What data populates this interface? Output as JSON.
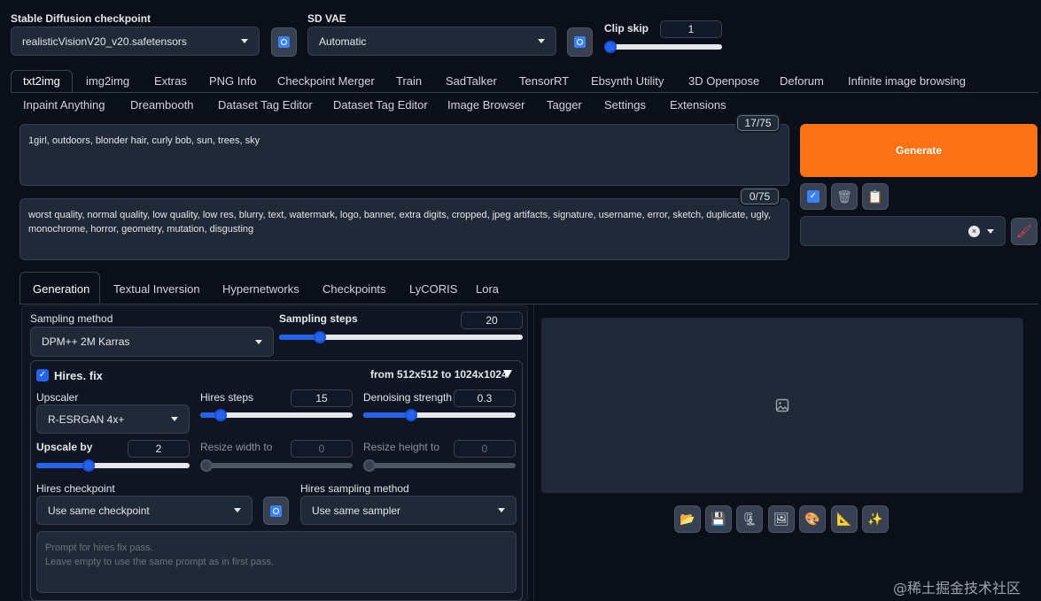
{
  "top": {
    "checkpoint_label": "Stable Diffusion checkpoint",
    "checkpoint_value": "realisticVisionV20_v20.safetensors",
    "vae_label": "SD VAE",
    "vae_value": "Automatic",
    "clip_label": "Clip skip",
    "clip_value": "1",
    "clip_level": 0.0
  },
  "tabs_row1": [
    "txt2img",
    "img2img",
    "Extras",
    "PNG Info",
    "Checkpoint Merger",
    "Train",
    "SadTalker",
    "TensorRT",
    "Ebsynth Utility",
    "3D Openpose",
    "Deforum",
    "Infinite image browsing"
  ],
  "tabs_row2": [
    "Inpaint Anything",
    "Dreambooth",
    "Dataset Tag Editor",
    "Dataset Tag Editor",
    "Image Browser",
    "Tagger",
    "Settings",
    "Extensions"
  ],
  "prompt": {
    "positive": "1girl, outdoors, blonder hair, curly bob, sun, trees, sky",
    "positive_count": "17/75",
    "negative": "worst quality, normal quality, low quality, low res, blurry, text, watermark, logo, banner, extra digits, cropped, jpeg artifacts, signature, username, error, sketch, duplicate, ugly, monochrome, horror, geometry, mutation, disgusting",
    "negative_count": "0/75"
  },
  "generate_label": "Generate",
  "sub_tabs": [
    "Generation",
    "Textual Inversion",
    "Hypernetworks",
    "Checkpoints",
    "LyCORIS",
    "Lora"
  ],
  "sampling": {
    "method_label": "Sampling method",
    "method_value": "DPM++ 2M Karras",
    "steps_label": "Sampling steps",
    "steps_value": "20",
    "steps_level": 0.15
  },
  "hires": {
    "label": "Hires. fix",
    "from_text": "from 512x512  to 1024x1024",
    "upscaler_label": "Upscaler",
    "upscaler_value": "R-ESRGAN 4x+",
    "steps_label": "Hires steps",
    "steps_value": "15",
    "steps_level": 0.1,
    "denoise_label": "Denoising strength",
    "denoise_value": "0.3",
    "denoise_level": 0.3,
    "upscale_label": "Upscale by",
    "upscale_value": "2",
    "upscale_level": 0.33,
    "rw_label": "Resize width to",
    "rw_value": "0",
    "rh_label": "Resize height to",
    "rh_value": "0",
    "ckpt_label": "Hires checkpoint",
    "ckpt_value": "Use same checkpoint",
    "sampler_label": "Hires sampling method",
    "sampler_value": "Use same sampler",
    "prompt_placeholder_1": "Prompt for hires fix pass.",
    "prompt_placeholder_2": "Leave empty to use the same prompt as in first pass."
  },
  "watermark": "@稀土掘金技术社区",
  "colors": {
    "accent": "#f97316",
    "bg": "#0b0f19",
    "blue": "#2563eb"
  }
}
